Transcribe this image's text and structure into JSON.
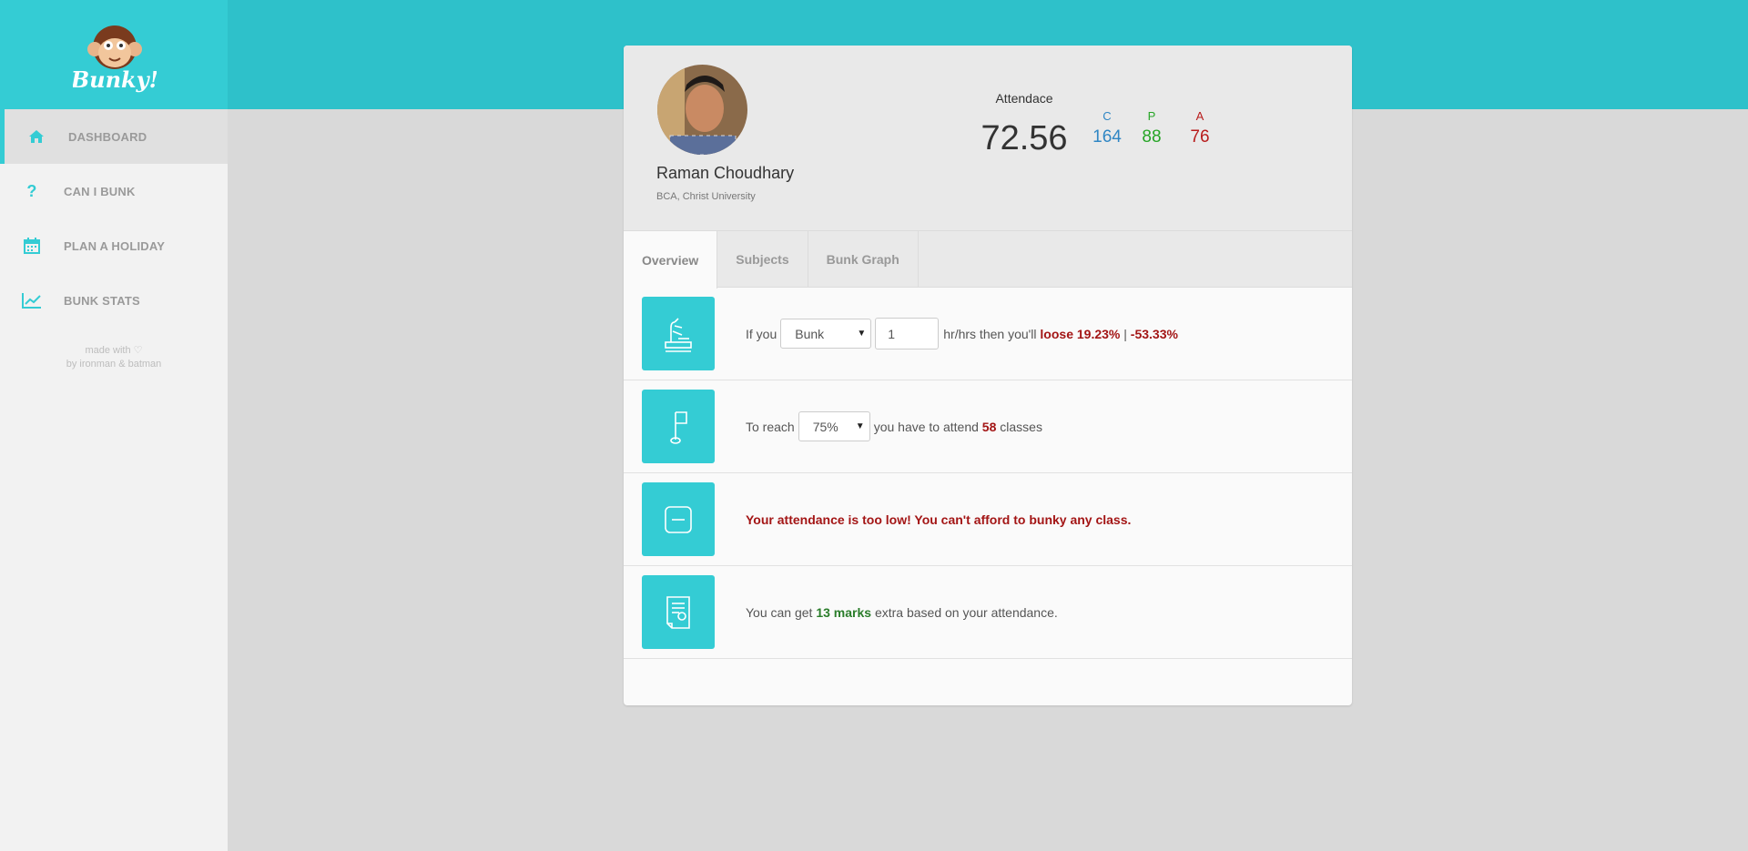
{
  "brand": {
    "name": "Bunky!"
  },
  "sidebar": {
    "items": [
      {
        "label": "DASHBOARD",
        "icon": "home-icon",
        "active": true
      },
      {
        "label": "CAN I BUNK",
        "icon": "question-icon",
        "active": false
      },
      {
        "label": "PLAN A HOLIDAY",
        "icon": "calendar-icon",
        "active": false
      },
      {
        "label": "BUNK STATS",
        "icon": "line-chart-icon",
        "active": false
      }
    ],
    "credits_line1": "made with ♡",
    "credits_line2": "by ironman & batman"
  },
  "profile": {
    "name": "Raman Choudhary",
    "subtitle": "BCA, Christ University"
  },
  "attendance": {
    "label": "Attendace",
    "value": "72.56",
    "stats": [
      {
        "key": "C",
        "value": "164",
        "color": "#2f86c4"
      },
      {
        "key": "P",
        "value": "88",
        "color": "#26a526"
      },
      {
        "key": "A",
        "value": "76",
        "color": "#b81c1c"
      }
    ]
  },
  "tabs": [
    {
      "label": "Overview",
      "active": true
    },
    {
      "label": "Subjects",
      "active": false
    },
    {
      "label": "Bunk Graph",
      "active": false
    }
  ],
  "overview": {
    "row1": {
      "prefix": "If you",
      "action_select": "Bunk",
      "hours_value": "1",
      "mid": "hr/hrs then you'll",
      "loose_label": "loose 19.23%",
      "sep": "|",
      "change": "-53.33%"
    },
    "row2": {
      "prefix": "To reach",
      "target_select": "75%",
      "mid": "you have to attend",
      "classes_count": "58",
      "suffix": "classes"
    },
    "row3": {
      "message": "Your attendance is too low! You can't afford to bunky any class."
    },
    "row4": {
      "prefix": "You can get",
      "marks": "13 marks",
      "suffix": "extra based on your attendance."
    }
  },
  "colors": {
    "accent": "#34ccd4",
    "header": "#2ec1ca"
  }
}
